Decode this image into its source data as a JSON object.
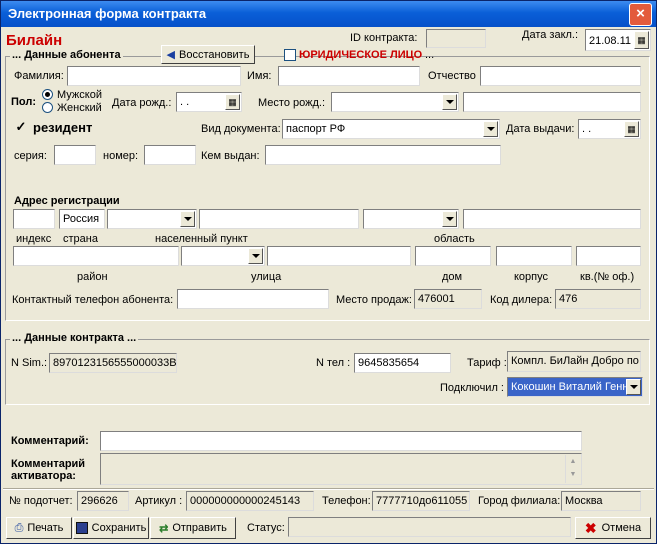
{
  "window": {
    "title": "Электронная форма контракта",
    "close": "×"
  },
  "brand": "Билайн",
  "header": {
    "contract_id_label": "ID контракта:",
    "contract_id_value": "",
    "date_label": "Дата закл.:",
    "date_value": "21.08.11"
  },
  "subscriber": {
    "group_label": "... Данные абонента",
    "restore_button": "Восстановить",
    "legal_entity_label": "ЮРИДИЧЕСКОЕ ЛИЦО",
    "legal_entity_suffix": "...",
    "surname_label": "Фамилия:",
    "surname_value": "",
    "name_label": "Имя:",
    "name_value": "",
    "patronymic_label": "Отчество",
    "patronymic_value": "",
    "sex_label": "Пол:",
    "male_label": "Мужской",
    "female_label": "Женский",
    "birthdate_label": "Дата рожд.:",
    "birthdate_value": " .  .",
    "birthplace_label": "Место рожд.:",
    "birthplace_select": "",
    "birthplace_value": "",
    "resident_label": "резидент",
    "doc_type_label": "Вид документа:",
    "doc_type_value": "паспорт РФ",
    "issue_date_label": "Дата выдачи:",
    "issue_date_value": " .  .",
    "series_label": "серия:",
    "series_value": "",
    "number_label": "номер:",
    "number_value": "",
    "issued_by_label": "Кем выдан:",
    "issued_by_value": ""
  },
  "address": {
    "title": "Адрес регистрации",
    "index_value": "",
    "country_value": "Россия",
    "locality_type": "",
    "locality_value": "",
    "region_type": "",
    "region_value": "",
    "index_label": "индекс",
    "country_label": "страна",
    "locality_label": "населенный пункт",
    "region_label": "область",
    "district_value": "",
    "street_type": "",
    "street_value": "",
    "house_value": "",
    "building_value": "",
    "flat_value": "",
    "district_label": "район",
    "street_label": "улица",
    "house_label": "дом",
    "building_label": "корпус",
    "flat_label": "кв.(№ оф.)",
    "phone_label": "Контактный телефон абонента:",
    "phone_value": "",
    "sale_place_label": "Место продаж:",
    "sale_place_value": "476001",
    "dealer_label": "Код дилера:",
    "dealer_value": "476"
  },
  "contract": {
    "group_label": "... Данные контракта ...",
    "sim_label": "N Sim.:",
    "sim_value": "8970123156555000033B",
    "phone_label": "N тел :",
    "phone_value": "9645835654",
    "tariff_label": "Тариф :",
    "tariff_value": "Компл. БиЛайн Добро по",
    "connected_label": "Подключил :",
    "connected_value": "Кокошин Виталий Генн"
  },
  "comments": {
    "comment_label": "Комментарий:",
    "comment_value": "",
    "activator_label": "Комментарий активатора:",
    "activator_value": ""
  },
  "footer": {
    "account_label": "№ подотчет:",
    "account_value": "296626",
    "article_label": "Артикул :",
    "article_value": "000000000000245143",
    "phone_label": "Телефон:",
    "phone_value": "7777710до611055",
    "city_label": "Город филиала:",
    "city_value": "Москва"
  },
  "actions": {
    "print": "Печать",
    "save": "Сохранить",
    "send": "Отправить",
    "status_label": "Статус:",
    "status_value": "",
    "cancel": "Отмена"
  }
}
